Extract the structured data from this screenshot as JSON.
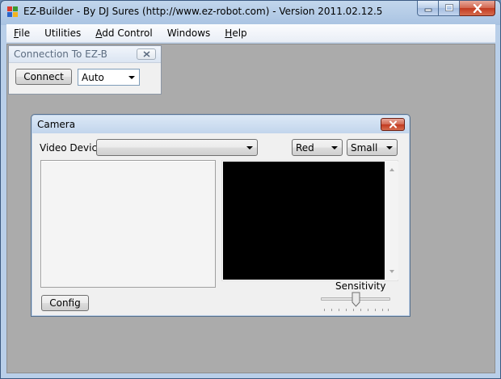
{
  "window": {
    "title": "EZ-Builder - By DJ Sures (http://www.ez-robot.com) - Version 2011.02.12.5"
  },
  "menu": {
    "items": [
      {
        "label": "File",
        "accel": "F",
        "rest": "ile"
      },
      {
        "label": "Utilities",
        "accel": "",
        "rest": "Utilities"
      },
      {
        "label": "Add Control",
        "accel": "A",
        "rest": "dd Control"
      },
      {
        "label": "Windows",
        "accel": "",
        "rest": "Windows"
      },
      {
        "label": "Help",
        "accel": "H",
        "rest": "elp"
      }
    ]
  },
  "connection": {
    "title": "Connection To EZ-B",
    "connect_label": "Connect",
    "port_value": "Auto"
  },
  "camera": {
    "title": "Camera",
    "video_device_label": "Video Device",
    "video_device_value": "",
    "color_value": "Red",
    "size_value": "Small",
    "sensitivity_label": "Sensitivity",
    "sensitivity_fraction": 0.5,
    "config_label": "Config"
  },
  "colors": {
    "video_background": "#000000",
    "client_background": "#ababab",
    "close_button": "#c23a20"
  }
}
